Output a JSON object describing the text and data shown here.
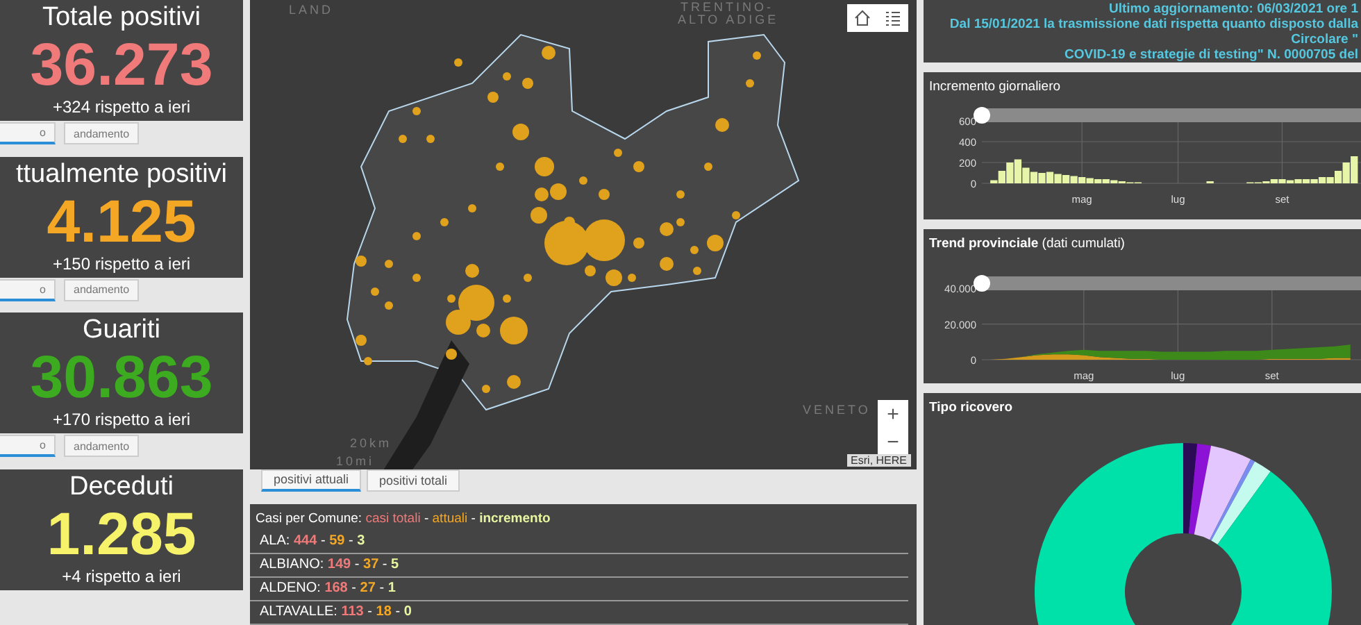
{
  "stat_cards": [
    {
      "title": "Totale positivi",
      "value": "36.273",
      "delta": "+324 rispetto a ieri",
      "color": "#f07a7a",
      "tabs": [
        {
          "label": "o",
          "selected": true
        },
        {
          "label": "andamento",
          "selected": false
        }
      ]
    },
    {
      "title": "ttualmente positivi",
      "value": "4.125",
      "delta": "+150 rispetto a ieri",
      "color": "#f3a724",
      "tabs": [
        {
          "label": "o",
          "selected": true
        },
        {
          "label": "andamento",
          "selected": false
        }
      ]
    },
    {
      "title": "Guariti",
      "value": "30.863",
      "delta": "+170 rispetto a ieri",
      "color": "#3cab1f",
      "tabs": [
        {
          "label": "o",
          "selected": true
        },
        {
          "label": "andamento",
          "selected": false
        }
      ]
    },
    {
      "title": "Deceduti",
      "value": "1.285",
      "delta": "+4 rispetto a ieri",
      "color": "#f6f36b"
    }
  ],
  "map": {
    "labels": [
      {
        "kind": "region",
        "text": "TRENTINO-"
      },
      {
        "kind": "region2",
        "text": "ALTO ADIGE"
      },
      {
        "kind": "veneto",
        "text": "VENETO"
      },
      {
        "kind": "corner",
        "text": "LAND"
      },
      {
        "kind": "scale_km",
        "text": "20km"
      },
      {
        "kind": "scale_mi",
        "text": "10mi"
      }
    ],
    "zoom_in": "+",
    "zoom_out": "−",
    "attribution": "Esri, HERE"
  },
  "map_tabs": [
    {
      "label": "positivi attuali",
      "selected": true
    },
    {
      "label": "positivi totali",
      "selected": false
    }
  ],
  "comuni": {
    "header": [
      {
        "kind": "label",
        "text": "Casi per Comune: "
      },
      {
        "kind": "total",
        "text": "casi totali"
      },
      {
        "kind": "sep",
        "text": " - "
      },
      {
        "kind": "current",
        "text": "attuali"
      },
      {
        "kind": "sep",
        "text": " - "
      },
      {
        "kind": "increment",
        "text": "incremento"
      }
    ],
    "separator": "-",
    "rows": [
      {
        "name": "ALA:",
        "total": "444",
        "current": "59",
        "increment": "3"
      },
      {
        "name": "ALBIANO:",
        "total": "149",
        "current": "37",
        "increment": "5"
      },
      {
        "name": "ALDENO:",
        "total": "168",
        "current": "27",
        "increment": "1"
      },
      {
        "name": "ALTAVALLE:",
        "total": "113",
        "current": "18",
        "increment": "0"
      }
    ]
  },
  "info": {
    "lines": [
      "Ultimo aggiornamento: 06/03/2021 ore 1",
      "Dal 15/01/2021 la trasmissione dati rispetta quanto disposto dalla Circolare \"",
      "COVID-19 e strategie di testing\" N. 0000705 del"
    ]
  },
  "daily_panel": {
    "title": "Incremento giornaliero",
    "chart_data": {
      "type": "bar",
      "categories": [
        null,
        null,
        null,
        null,
        null,
        null,
        null,
        null,
        null,
        null,
        null,
        null,
        "mag",
        null,
        null,
        null,
        null,
        null,
        null,
        null,
        null,
        null,
        null,
        null,
        "lug",
        null,
        null,
        null,
        null,
        null,
        null,
        null,
        null,
        null,
        null,
        null,
        null,
        "set",
        null,
        null,
        null,
        null,
        null,
        null,
        null,
        null,
        null
      ],
      "series": [
        {
          "color": "#e6f5a8",
          "values": [
            0,
            30,
            120,
            200,
            230,
            150,
            110,
            100,
            110,
            90,
            80,
            70,
            60,
            50,
            40,
            40,
            30,
            20,
            10,
            10,
            0,
            0,
            0,
            0,
            0,
            0,
            0,
            0,
            20,
            0,
            0,
            0,
            0,
            10,
            10,
            20,
            40,
            40,
            30,
            40,
            40,
            40,
            60,
            60,
            120,
            200,
            260
          ]
        }
      ],
      "ylim": [
        0,
        640
      ],
      "yticks": [
        0,
        200,
        400,
        600
      ],
      "grid": true
    }
  },
  "trend_panel": {
    "title": "**Trend provinciale** (dati cumulati)",
    "chart_data": {
      "type": "area",
      "stacked": true,
      "categories": [
        null,
        null,
        null,
        null,
        null,
        null,
        "mag",
        null,
        null,
        null,
        null,
        null,
        "lug",
        null,
        null,
        null,
        null,
        null,
        "set",
        null,
        null,
        null,
        null,
        null
      ],
      "series": [
        {
          "color": "#d49a1c",
          "values": [
            0,
            500,
            1500,
            2500,
            3000,
            3000,
            2500,
            1500,
            1000,
            500,
            500,
            0,
            0,
            0,
            0,
            0,
            0,
            0,
            500,
            500,
            500,
            500,
            1000,
            1000
          ]
        },
        {
          "color": "#3d8a1a",
          "values": [
            0,
            0,
            0,
            500,
            1000,
            2000,
            3000,
            3500,
            4000,
            4500,
            4500,
            4500,
            4500,
            4500,
            4500,
            5000,
            5000,
            5000,
            5000,
            5500,
            6000,
            6500,
            6500,
            7500
          ]
        }
      ],
      "grid": true,
      "ylim": [
        0,
        42000
      ],
      "yticks": [
        0,
        {
          "value": 20000,
          "label": "20.000"
        },
        {
          "value": 40000,
          "label": "40.000"
        }
      ]
    }
  },
  "ricovero_panel": {
    "title": "Tipo ricovero"
  }
}
